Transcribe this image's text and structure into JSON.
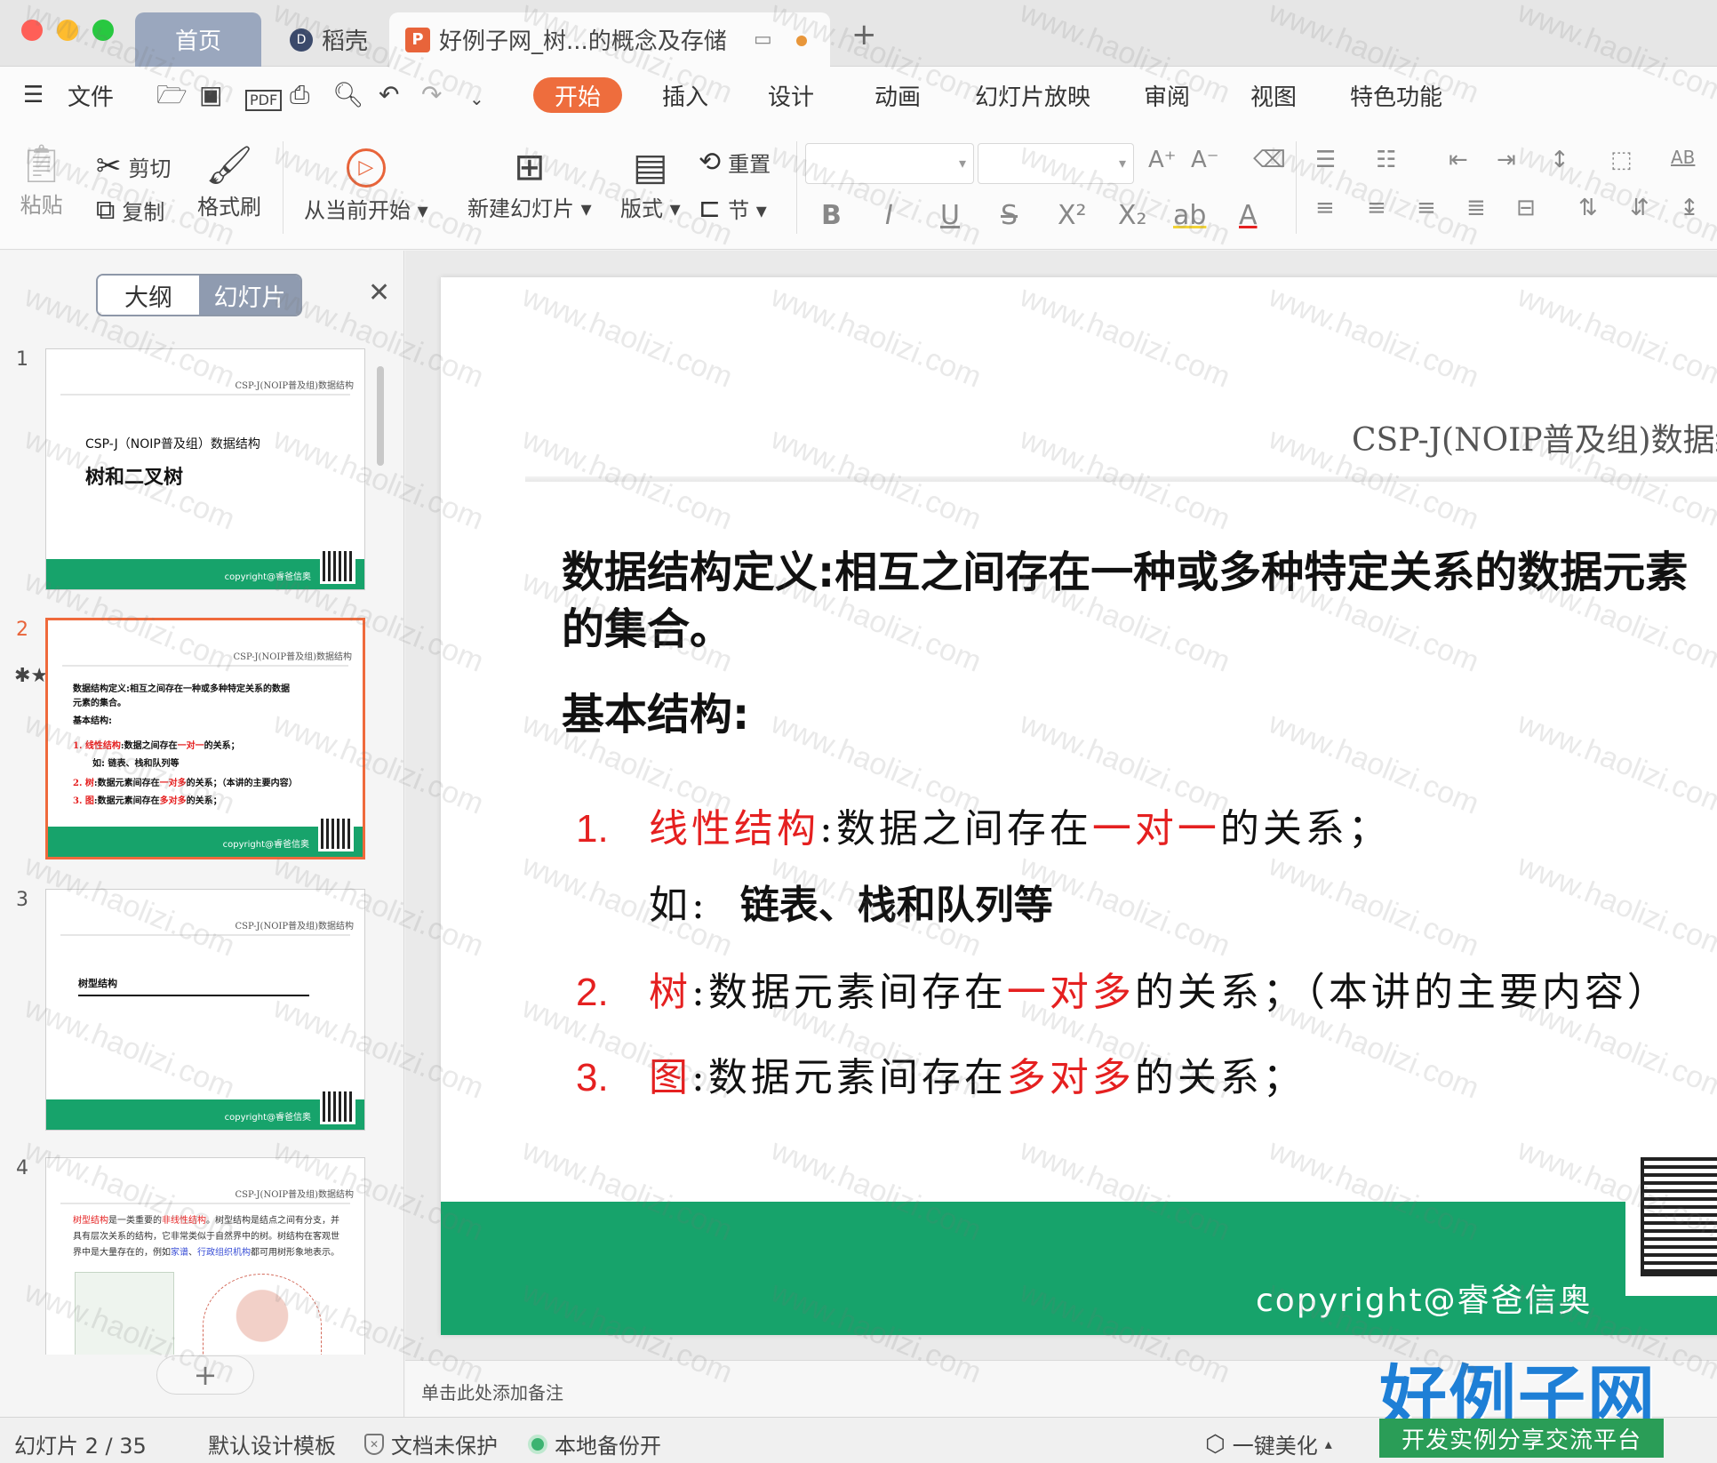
{
  "tabs": {
    "home": "首页",
    "daoke": "稻壳",
    "document": "好例子网_树...的概念及存储",
    "new_tab": "+"
  },
  "menu": {
    "file": "文件",
    "items": [
      "开始",
      "插入",
      "设计",
      "动画",
      "幻灯片放映",
      "审阅",
      "视图",
      "特色功能"
    ],
    "active": "开始"
  },
  "ribbon": {
    "paste": "粘贴",
    "cut": "剪切",
    "copy": "复制",
    "format_painter": "格式刷",
    "play_from_current": "从当前开始",
    "new_slide": "新建幻灯片",
    "layout": "版式",
    "reset": "重置",
    "section": "节",
    "font_name": "",
    "font_size": ""
  },
  "left_pane": {
    "outline_tab": "大纲",
    "slides_tab": "幻灯片",
    "slide_numbers": [
      "1",
      "2",
      "3",
      "4"
    ],
    "header_text": "CSP-J(NOIP普及组)数据结构",
    "copyright": "copyright@睿爸信奥",
    "slide1": {
      "subtitle": "CSP-J（NOIP普及组）数据结构",
      "title": "树和二叉树"
    },
    "slide2": {
      "l1": "数据结构定义:相互之间存在一种或多种特定关系的数据",
      "l2": "元素的集合。",
      "l3": "基本结构:",
      "l4a": "1.  线性结构",
      "l4b": ":数据之间存在",
      "l4c": "一对一",
      "l4d": "的关系；",
      "l5": "如:  链表、栈和队列等",
      "l6a": "2.  树",
      "l6b": ":数据元素间存在",
      "l6c": "一对多",
      "l6d": "的关系；（本讲的主要内容）",
      "l7a": "3.  图",
      "l7b": ":数据元素间存在",
      "l7c": "多对多",
      "l7d": "的关系；"
    },
    "slide3": {
      "title": "树型结构"
    },
    "slide4": {
      "p_a": "树型结构",
      "p_b": "是一类重要的",
      "p_c": "非线性结构",
      "p_d": "。树型结构是结点之间有分支，并具有层次关系的结构，它非常类似于自然界中的树。树结构在客观世界中是大量存在的，例如",
      "p_e": "家谱",
      "p_f": "、",
      "p_g": "行政组织机构",
      "p_h": "都可用树形象地表示。"
    }
  },
  "slide": {
    "header": "CSP-J(NOIP普及组)数据结构",
    "definition": "数据结构定义:相互之间存在一种或多种特定关系的数据元素的集合。",
    "basic": "基本结构:",
    "items": [
      {
        "num": "1.",
        "name": "线性结构",
        "mid": ":数据之间存在",
        "rel": "一对一",
        "tail": "的关系；"
      },
      {
        "num": "2.",
        "name": "树",
        "mid": ":数据元素间存在",
        "rel": "一对多",
        "tail": "的关系；（本讲的主要内容）"
      },
      {
        "num": "3.",
        "name": "图",
        "mid": ":数据元素间存在",
        "rel": "多对多",
        "tail": "的关系；"
      }
    ],
    "example_prefix": "如:",
    "example": "链表、栈和队列等",
    "copyright": "copyright@睿爸信奥"
  },
  "notes_placeholder": "单击此处添加备注",
  "status": {
    "slide_counter": "幻灯片 2 / 35",
    "template": "默认设计模板",
    "protection": "文档未保护",
    "backup": "本地备份开",
    "beautify": "一键美化"
  },
  "watermark": {
    "brand": "好例子网",
    "brand_sub": "开发实例分享交流平台",
    "text": "www.haolizi.com"
  },
  "colors": {
    "accent_orange": "#ee6d3d",
    "slide_green": "#17a36b",
    "emphasis_red": "#e52020",
    "brand_blue": "#1e7fd6"
  }
}
